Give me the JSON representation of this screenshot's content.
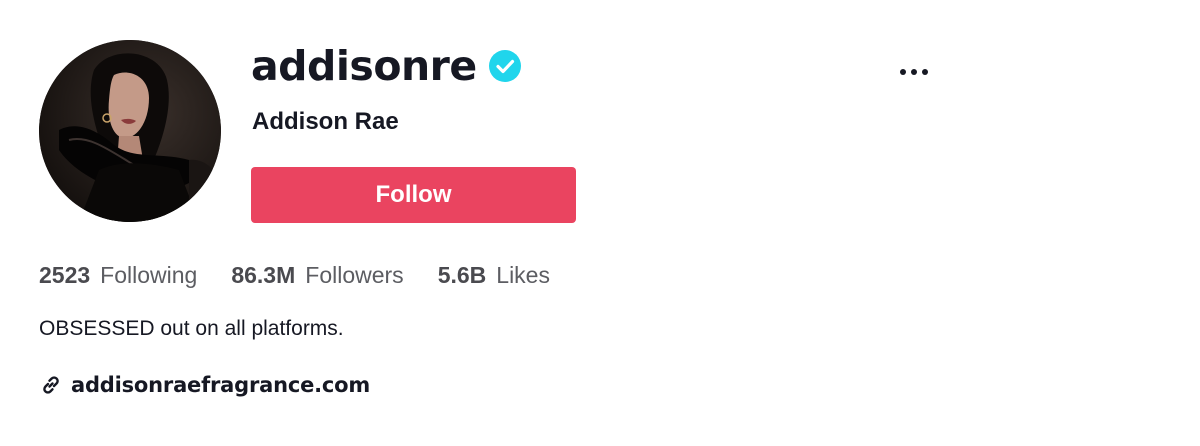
{
  "profile": {
    "username": "addisonre",
    "display_name": "Addison Rae",
    "verified": true,
    "follow_label": "Follow",
    "bio": "OBSESSED out on all platforms.",
    "link": "addisonraefragrance.com"
  },
  "stats": [
    {
      "value": "2523",
      "label": "Following"
    },
    {
      "value": "86.3M",
      "label": "Followers"
    },
    {
      "value": "5.6B",
      "label": "Likes"
    }
  ],
  "icons": {
    "verified": "verified-check-icon",
    "more": "more-options-icon",
    "link": "link-chain-icon"
  },
  "colors": {
    "follow_button": "#ea4460",
    "verified_badge": "#20d5ec",
    "text": "#161823",
    "secondary_text": "#5c5d62"
  }
}
